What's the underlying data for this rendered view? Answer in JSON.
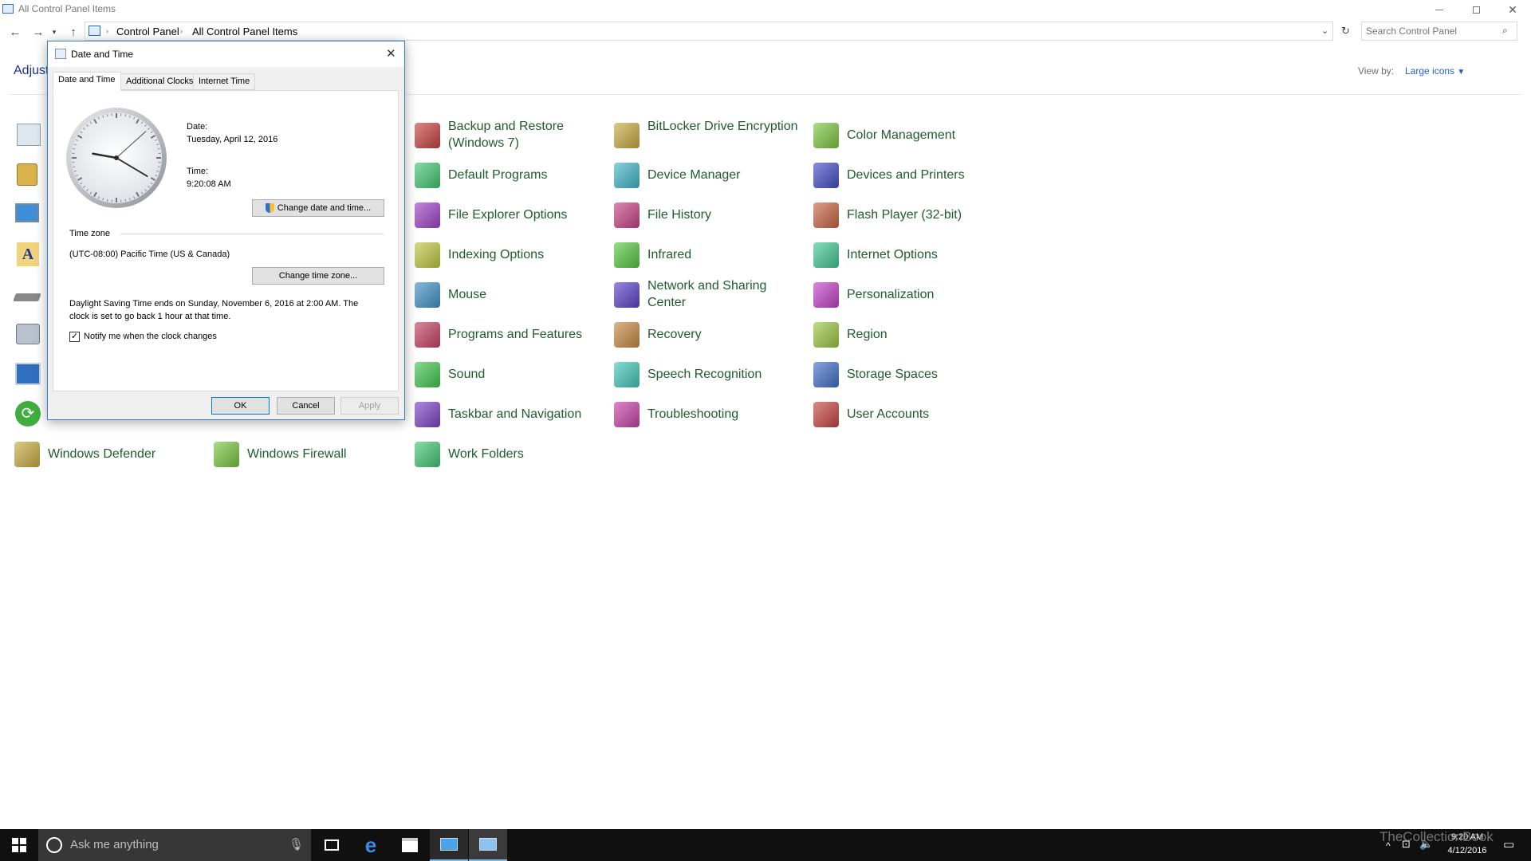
{
  "window": {
    "title": "All Control Panel Items"
  },
  "nav": {
    "breadcrumb": [
      "Control Panel",
      "All Control Panel Items"
    ],
    "search_placeholder": "Search Control Panel"
  },
  "header": {
    "title_partial": "Adjust",
    "view_by_label": "View by:",
    "view_by_value": "Large icons"
  },
  "items": [
    {
      "label": "Backup and Restore (Windows 7)",
      "icon": "backup-restore-icon"
    },
    {
      "label": "BitLocker Drive Encryption",
      "icon": "bitlocker-icon"
    },
    {
      "label": "Color Management",
      "icon": "color-management-icon"
    },
    {
      "label": "Default Programs",
      "icon": "default-programs-icon"
    },
    {
      "label": "Device Manager",
      "icon": "device-manager-icon"
    },
    {
      "label": "Devices and Printers",
      "icon": "devices-printers-icon"
    },
    {
      "label": "File Explorer Options",
      "icon": "file-explorer-options-icon"
    },
    {
      "label": "File History",
      "icon": "file-history-icon"
    },
    {
      "label": "Flash Player (32-bit)",
      "icon": "flash-player-icon"
    },
    {
      "label": "Indexing Options",
      "icon": "indexing-options-icon"
    },
    {
      "label": "Infrared",
      "icon": "infrared-icon"
    },
    {
      "label": "Internet Options",
      "icon": "internet-options-icon"
    },
    {
      "label": "Mouse",
      "icon": "mouse-icon"
    },
    {
      "label": "Network and Sharing Center",
      "icon": "network-sharing-icon"
    },
    {
      "label": "Personalization",
      "icon": "personalization-icon"
    },
    {
      "label": "Programs and Features",
      "icon": "programs-features-icon"
    },
    {
      "label": "Recovery",
      "icon": "recovery-icon"
    },
    {
      "label": "Region",
      "icon": "region-icon"
    },
    {
      "label": "Sound",
      "icon": "sound-icon"
    },
    {
      "label": "Speech Recognition",
      "icon": "speech-recognition-icon"
    },
    {
      "label": "Storage Spaces",
      "icon": "storage-spaces-icon"
    },
    {
      "label": "Taskbar and Navigation",
      "icon": "taskbar-navigation-icon"
    },
    {
      "label": "Troubleshooting",
      "icon": "troubleshooting-icon"
    },
    {
      "label": "User Accounts",
      "icon": "user-accounts-icon"
    },
    {
      "label": "Windows Defender",
      "icon": "windows-defender-icon"
    },
    {
      "label": "Windows Firewall",
      "icon": "windows-firewall-icon"
    },
    {
      "label": "Work Folders",
      "icon": "work-folders-icon"
    }
  ],
  "dialog": {
    "title": "Date and Time",
    "tabs": [
      "Date and Time",
      "Additional Clocks",
      "Internet Time"
    ],
    "date_label": "Date:",
    "date_value": "Tuesday, April 12, 2016",
    "time_label": "Time:",
    "time_value": "9:20:08 AM",
    "clock": {
      "hour": 9,
      "minute": 20,
      "second": 8
    },
    "change_datetime_button": "Change date and time...",
    "timezone_section": "Time zone",
    "timezone_value": "(UTC-08:00) Pacific Time (US & Canada)",
    "change_timezone_button": "Change time zone...",
    "dst_line1": "Daylight Saving Time ends on Sunday, November 6, 2016 at 2:00 AM. The",
    "dst_line2": "clock is set to go back 1 hour at that time.",
    "notify_label": "Notify me when the clock changes",
    "notify_checked": true,
    "ok_button": "OK",
    "cancel_button": "Cancel",
    "apply_button": "Apply"
  },
  "taskbar": {
    "cortana_placeholder": "Ask me anything",
    "time": "9:20 AM",
    "date": "4/12/2016"
  },
  "watermark": "TheCollectionBook",
  "colors": {
    "link_green": "#1f5c2c",
    "accent_blue": "#0078d7",
    "taskbar": "#101010"
  }
}
